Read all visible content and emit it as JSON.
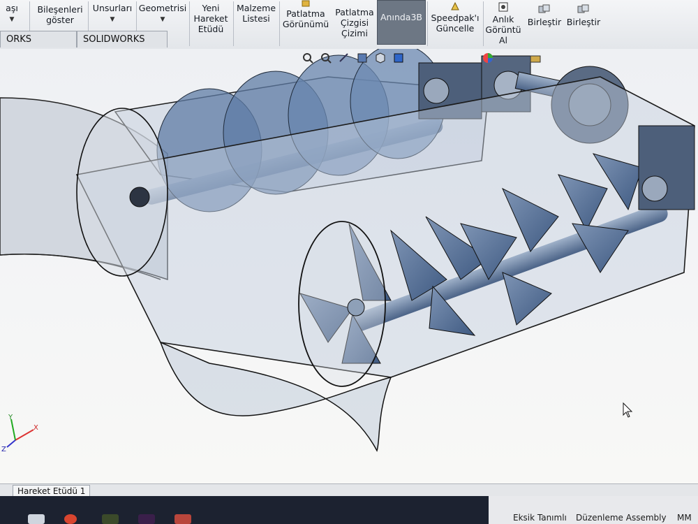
{
  "ribbon": {
    "items": [
      {
        "label_lines": [
          "aşı"
        ],
        "has_caret": true
      },
      {
        "label_lines": [
          "Bileşenleri",
          "göster"
        ],
        "has_caret": false
      },
      {
        "label_lines": [
          "Unsurları"
        ],
        "has_caret": true
      },
      {
        "label_lines": [
          "Geometrisi"
        ],
        "has_caret": true
      },
      {
        "label_lines": [
          "Yeni",
          "Hareket",
          "Etüdü"
        ],
        "has_caret": false
      },
      {
        "label_lines": [
          "Malzeme",
          "Listesi"
        ],
        "has_caret": false
      },
      {
        "label_lines": [
          "Patlatma",
          "Görünümü"
        ],
        "has_caret": false
      },
      {
        "label_lines": [
          "Patlatma",
          "Çizgisi",
          "Çizimi"
        ],
        "has_caret": false
      },
      {
        "label_lines": [
          "Anında3B"
        ],
        "has_caret": false,
        "active": true
      },
      {
        "label_lines": [
          "Speedpak'ı",
          "Güncelle"
        ],
        "has_caret": false
      },
      {
        "label_lines": [
          "Anlık",
          "Görüntü",
          "Al"
        ],
        "has_caret": false
      },
      {
        "label_lines": [
          "Birleştir"
        ],
        "has_caret": false
      },
      {
        "label_lines": [
          "Birleştir"
        ],
        "has_caret": false
      }
    ]
  },
  "tabs": {
    "addins": "ORKS Eklentileri",
    "mbd": "SOLIDWORKS MBD"
  },
  "motion_study": {
    "tab_label": "Hareket Etüdü 1"
  },
  "status": {
    "definition": "Eksik Tanımlı",
    "mode": "Düzenleme Assembly",
    "units": "MM"
  },
  "triad": {
    "x": "X",
    "y": "Y",
    "z": "Z"
  },
  "colors": {
    "accent_active": "#6d7784",
    "model_blue": "#5b7aa6",
    "taskbar": "#1c2230"
  }
}
